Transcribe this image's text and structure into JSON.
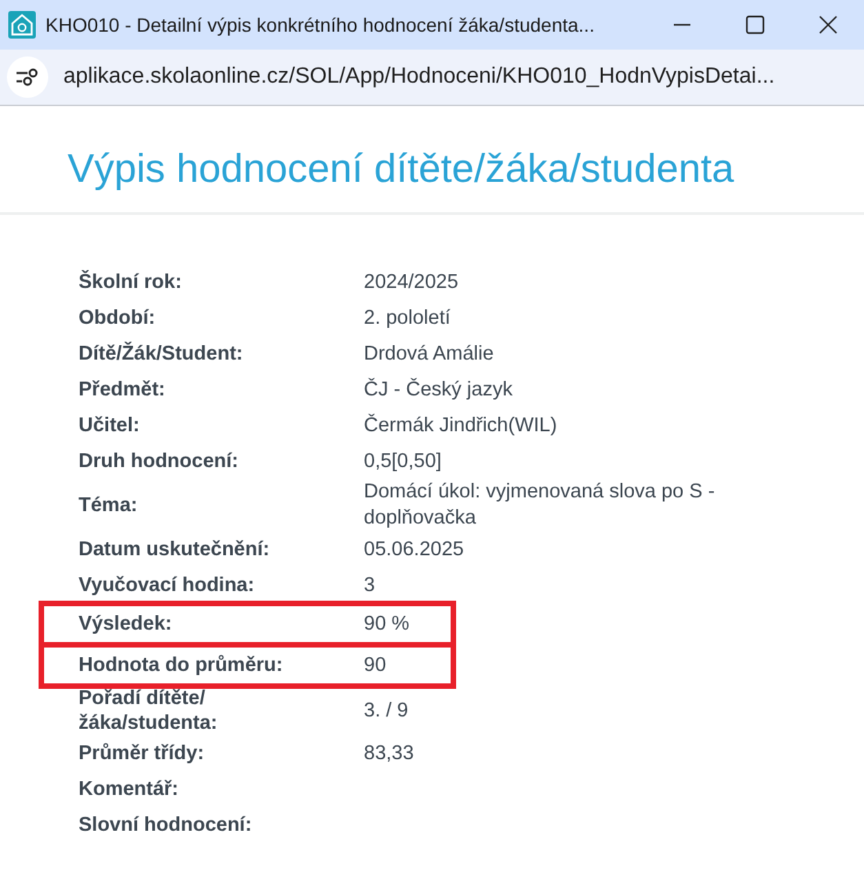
{
  "window": {
    "title": "KHO010 - Detailní výpis konkrétního hodnocení žáka/studenta..."
  },
  "address_bar": {
    "url": "aplikace.skolaonline.cz/SOL/App/Hodnoceni/KHO010_HodnVypisDetai..."
  },
  "page": {
    "title": "Výpis hodnocení dítěte/žáka/studenta"
  },
  "details": [
    {
      "label": "Školní rok:",
      "value": "2024/2025",
      "highlighted": false
    },
    {
      "label": "Období:",
      "value": "2. pololetí",
      "highlighted": false
    },
    {
      "label": "Dítě/Žák/Student:",
      "value": "Drdová Amálie",
      "highlighted": false
    },
    {
      "label": "Předmět:",
      "value": "ČJ - Český jazyk",
      "highlighted": false
    },
    {
      "label": "Učitel:",
      "value": "Čermák Jindřich(WIL)",
      "highlighted": false
    },
    {
      "label": "Druh hodnocení:",
      "value": "0,5[0,50]",
      "highlighted": false
    },
    {
      "label": "Téma:",
      "value": "Domácí úkol: vyjmenovaná slova po S - doplňovačka",
      "highlighted": false
    },
    {
      "label": "Datum uskutečnění:",
      "value": "05.06.2025",
      "highlighted": false
    },
    {
      "label": "Vyučovací hodina:",
      "value": "3",
      "highlighted": false
    },
    {
      "label": "Výsledek:",
      "value": "90 %",
      "highlighted": true
    },
    {
      "label": "Hodnota do průměru:",
      "value": "90",
      "highlighted": true
    },
    {
      "label": "Pořadí dítěte/ žáka/studenta:",
      "value": "3. / 9",
      "highlighted": false
    },
    {
      "label": "Průměr třídy:",
      "value": "83,33",
      "highlighted": false
    },
    {
      "label": "Komentář:",
      "highlighted": false
    },
    {
      "label": "Slovní hodnocení:",
      "highlighted": false
    }
  ]
}
